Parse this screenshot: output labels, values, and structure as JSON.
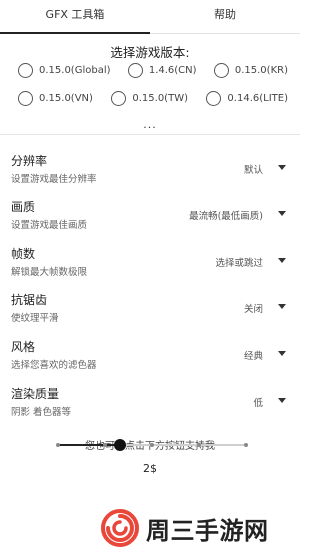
{
  "tabs": [
    {
      "label": "GFX 工具箱",
      "active": true
    },
    {
      "label": "帮助",
      "active": false
    }
  ],
  "version_section": {
    "title": "选择游戏版本:",
    "options": [
      {
        "label": "0.15.0(Global)",
        "selected": false
      },
      {
        "label": "1.4.6(CN)",
        "selected": false
      },
      {
        "label": "0.15.0(KR)",
        "selected": false
      },
      {
        "label": "0.15.0(VN)",
        "selected": false
      },
      {
        "label": "0.15.0(TW)",
        "selected": false
      },
      {
        "label": "0.14.6(LITE)",
        "selected": false
      }
    ],
    "more": "..."
  },
  "settings": [
    {
      "title": "分辨率",
      "desc": "设置游戏最佳分辨率",
      "value": "默认"
    },
    {
      "title": "画质",
      "desc": "设置游戏最佳画质",
      "value": "最流畅(最低画质)"
    },
    {
      "title": "帧数",
      "desc": "解锁最大帧数极限",
      "value": "选择或跳过"
    },
    {
      "title": "抗锯齿",
      "desc": "使纹理平滑",
      "value": "关闭"
    },
    {
      "title": "风格",
      "desc": "选择您喜欢的滤色器",
      "value": "经典"
    },
    {
      "title": "渲染质量",
      "desc": "阴影 着色器等",
      "value": "低"
    }
  ],
  "support": {
    "text": "您也可以点击下方按钮支持我",
    "slider": {
      "steps": 5,
      "selected_step": 1,
      "fraction": 0.33
    },
    "amount": "2$"
  },
  "watermark": {
    "text": "周三手游网",
    "icon": "swirl-logo-icon",
    "color": "#e8473a"
  }
}
